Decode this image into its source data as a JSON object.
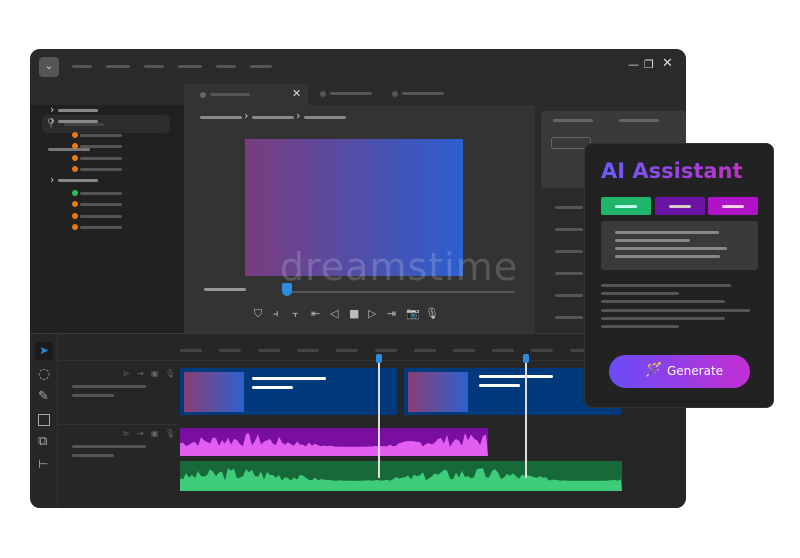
{
  "assistant": {
    "title": "AI Assistant",
    "generate_label": "Generate",
    "tab_colors": [
      "#1fb56a",
      "#6a14a6",
      "#b012c8"
    ]
  },
  "watermark": "dreamstime",
  "colors": {
    "accent_blue": "#2a8de0",
    "clip_blue": "#013a7a",
    "audio_purple": "#7a0ea0",
    "audio_pink": "#e25ef0",
    "audio_green_dark": "#17693a",
    "audio_green": "#3fcc7a"
  }
}
